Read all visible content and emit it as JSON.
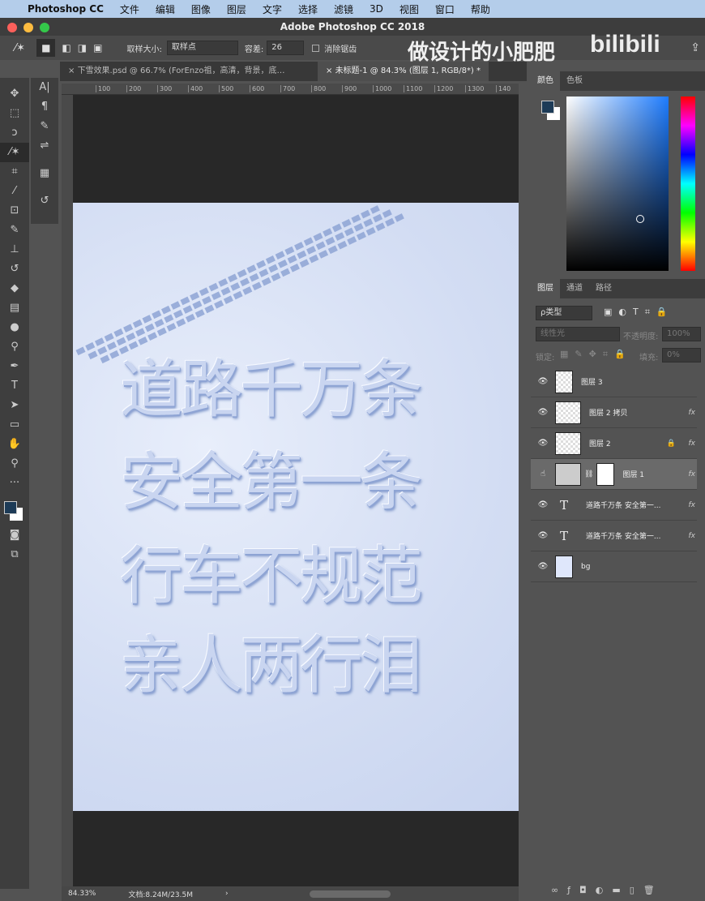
{
  "menubar": {
    "app": "Photoshop CC",
    "items": [
      "文件",
      "编辑",
      "图像",
      "图层",
      "文字",
      "选择",
      "滤镜",
      "3D",
      "视图",
      "窗口",
      "帮助"
    ]
  },
  "window": {
    "title": "Adobe Photoshop CC 2018"
  },
  "options": {
    "sample_size_label": "取样大小:",
    "sample_size_value": "取样点",
    "tolerance_label": "容差:",
    "tolerance_value": "26",
    "antialias_label": "消除锯齿"
  },
  "watermark": {
    "text": "做设计的小肥肥",
    "logo": "bilibili"
  },
  "tabs": [
    {
      "label": "下雪效果.psd @ 66.7% (ForEnzo祖，高清，背景，底…"
    },
    {
      "label": "未标题-1 @ 84.3% (图层 1, RGB/8*) *"
    }
  ],
  "ruler": [
    "100",
    "200",
    "300",
    "400",
    "500",
    "600",
    "700",
    "800",
    "900",
    "1000",
    "1100",
    "1200",
    "1300",
    "140"
  ],
  "canvas": {
    "lines": [
      "道路千万条",
      "安全第一条",
      "行车不规范",
      "亲人两行泪"
    ]
  },
  "color_panel": {
    "tabs": [
      "颜色",
      "色板"
    ],
    "foreground": "#1d3b57",
    "background": "#ffffff"
  },
  "layers_panel": {
    "tabs": [
      "图层",
      "通道",
      "路径"
    ],
    "filter": "ρ类型",
    "blend": "线性光",
    "opacity_label": "不透明度:",
    "opacity": "100%",
    "lock_label": "锁定:",
    "fill_label": "填充:",
    "fill": "0%",
    "layers": [
      {
        "name": "图层 3",
        "fx": ""
      },
      {
        "name": "图层 2 拷贝",
        "fx": "fx"
      },
      {
        "name": "图层 2",
        "fx": "fx"
      },
      {
        "name": "图层 1",
        "fx": "fx"
      },
      {
        "name": "道路千万条 安全第一...",
        "fx": "fx"
      },
      {
        "name": "道路千万条 安全第一...",
        "fx": "fx"
      },
      {
        "name": "bg",
        "fx": ""
      }
    ]
  },
  "status": {
    "zoom": "84.33%",
    "doc": "文档:8.24M/23.5M"
  }
}
